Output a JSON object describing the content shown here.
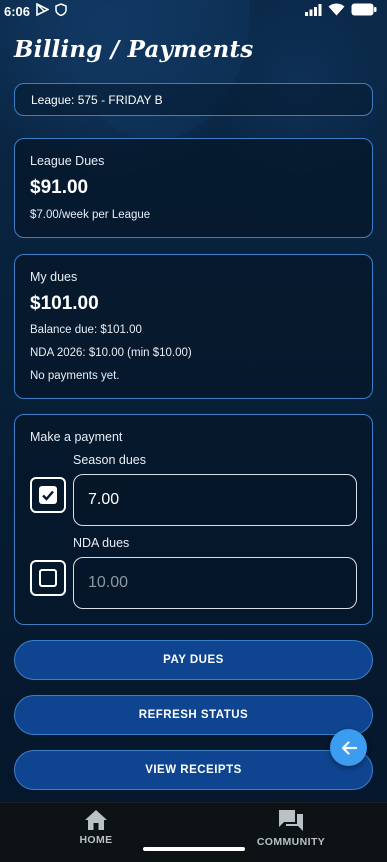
{
  "status_bar": {
    "time": "6:06"
  },
  "header": {
    "title": "Billing / Payments"
  },
  "league_selector": {
    "value": "League: 575 - FRIDAY B"
  },
  "league_dues": {
    "label": "League Dues",
    "amount": "$91.00",
    "rate": "$7.00/week per League"
  },
  "my_dues": {
    "label": "My dues",
    "amount": "$101.00",
    "balance": "Balance due: $101.00",
    "nda": "NDA 2026: $10.00 (min $10.00)",
    "payments": "No payments yet."
  },
  "payment": {
    "title": "Make a payment",
    "season": {
      "label": "Season dues",
      "value": "7.00",
      "checked": true
    },
    "nda": {
      "label": "NDA dues",
      "placeholder": "10.00",
      "checked": false
    }
  },
  "buttons": {
    "pay": "PAY DUES",
    "refresh": "REFRESH STATUS",
    "receipts": "VIEW RECEIPTS"
  },
  "bottom_nav": {
    "home": "HOME",
    "community": "COMMUNITY"
  },
  "colors": {
    "accent_border": "#3d7fc6",
    "button_fill": "#0f4590",
    "fab": "#3b9cf0"
  },
  "icons": [
    "play-store-icon",
    "shield-icon",
    "signal-icon",
    "wifi-icon",
    "battery-icon",
    "checkmark-icon",
    "arrow-left-icon",
    "home-icon",
    "forum-icon"
  ]
}
